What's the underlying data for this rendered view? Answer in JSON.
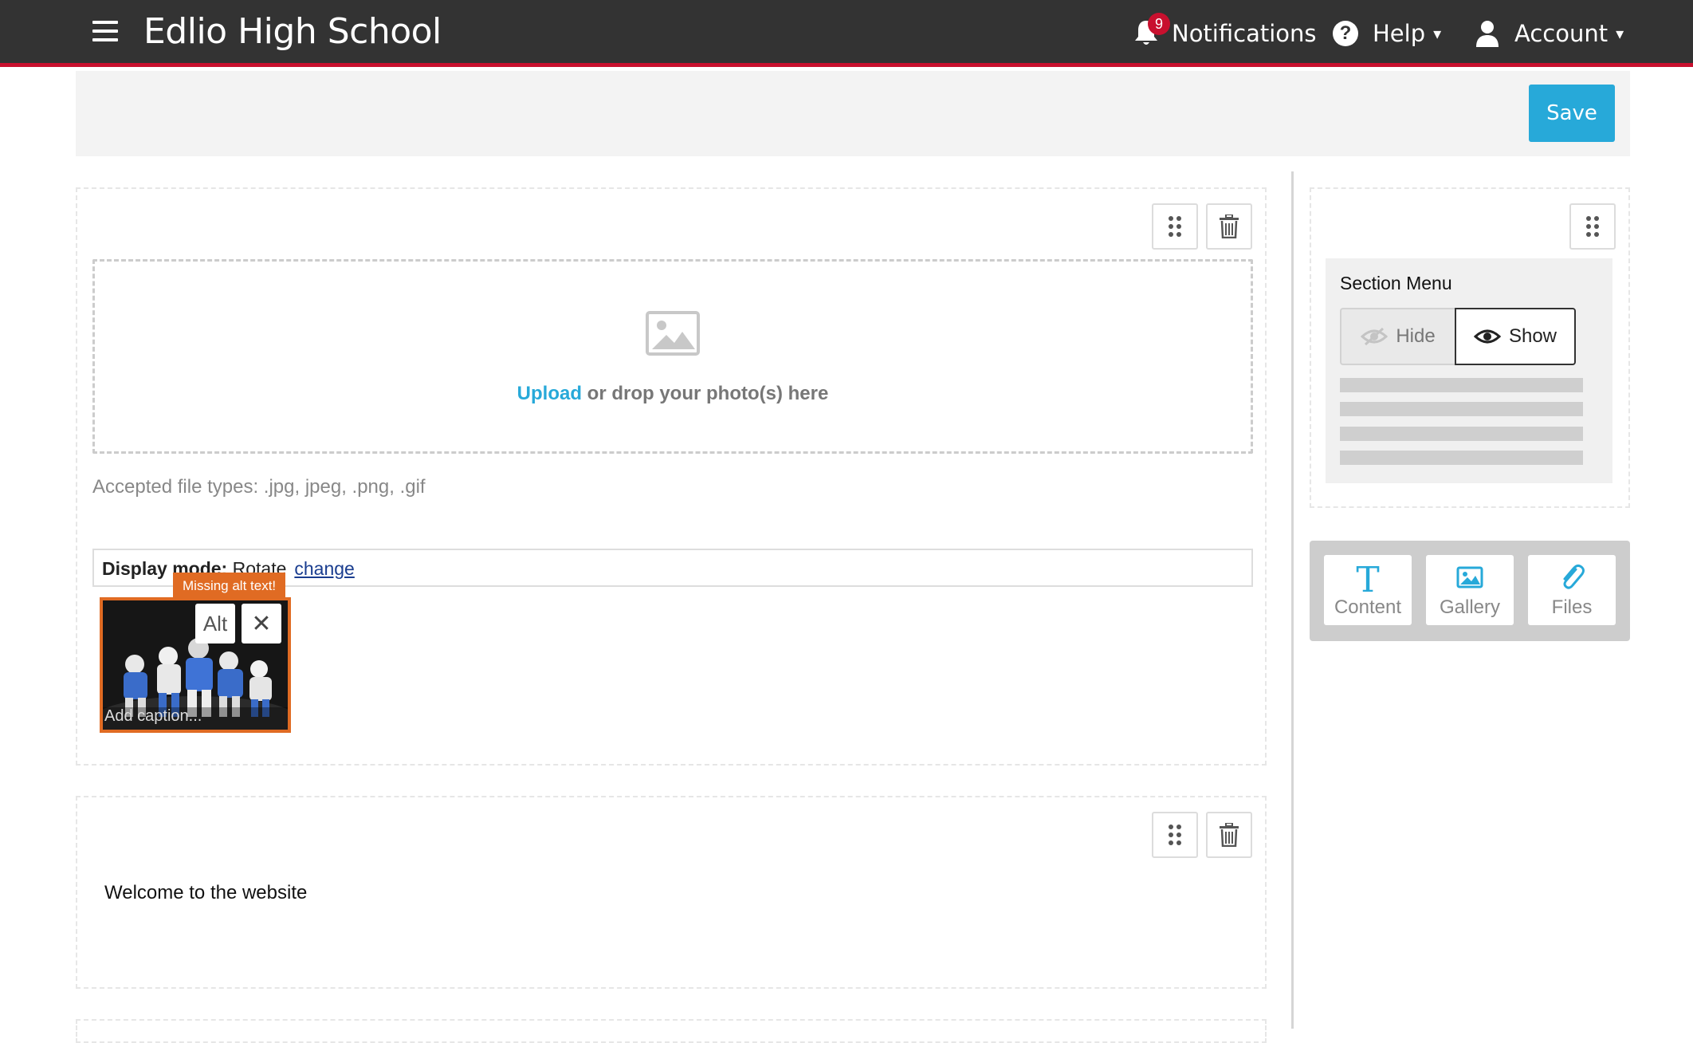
{
  "header": {
    "site_title": "Edlio High School",
    "notifications_label": "Notifications",
    "notifications_count": "9",
    "help_label": "Help",
    "account_label": "Account",
    "help_glyph": "?",
    "caret": "▾",
    "accent_color": "#c8102e"
  },
  "toolbar": {
    "save_label": "Save",
    "save_color": "#27a9d9"
  },
  "photo_block": {
    "upload_link": "Upload",
    "drop_text": " or drop your photo(s) here",
    "accepted_types": "Accepted file types: .jpg, jpeg, .png, .gif",
    "display_mode_label": "Display mode:",
    "display_mode_value": " Rotate",
    "change_link": "change",
    "missing_alt_tag": "Missing alt text!",
    "alt_button": "Alt",
    "remove_glyph": "✕",
    "caption_placeholder": "Add caption..."
  },
  "text_block": {
    "content": "Welcome to the website"
  },
  "sidebar": {
    "section_menu_title": "Section Menu",
    "hide_label": "Hide",
    "show_label": "Show",
    "add_buttons": [
      {
        "label": "Content",
        "icon": "text-icon"
      },
      {
        "label": "Gallery",
        "icon": "image-icon"
      },
      {
        "label": "Files",
        "icon": "paperclip-icon"
      }
    ]
  }
}
